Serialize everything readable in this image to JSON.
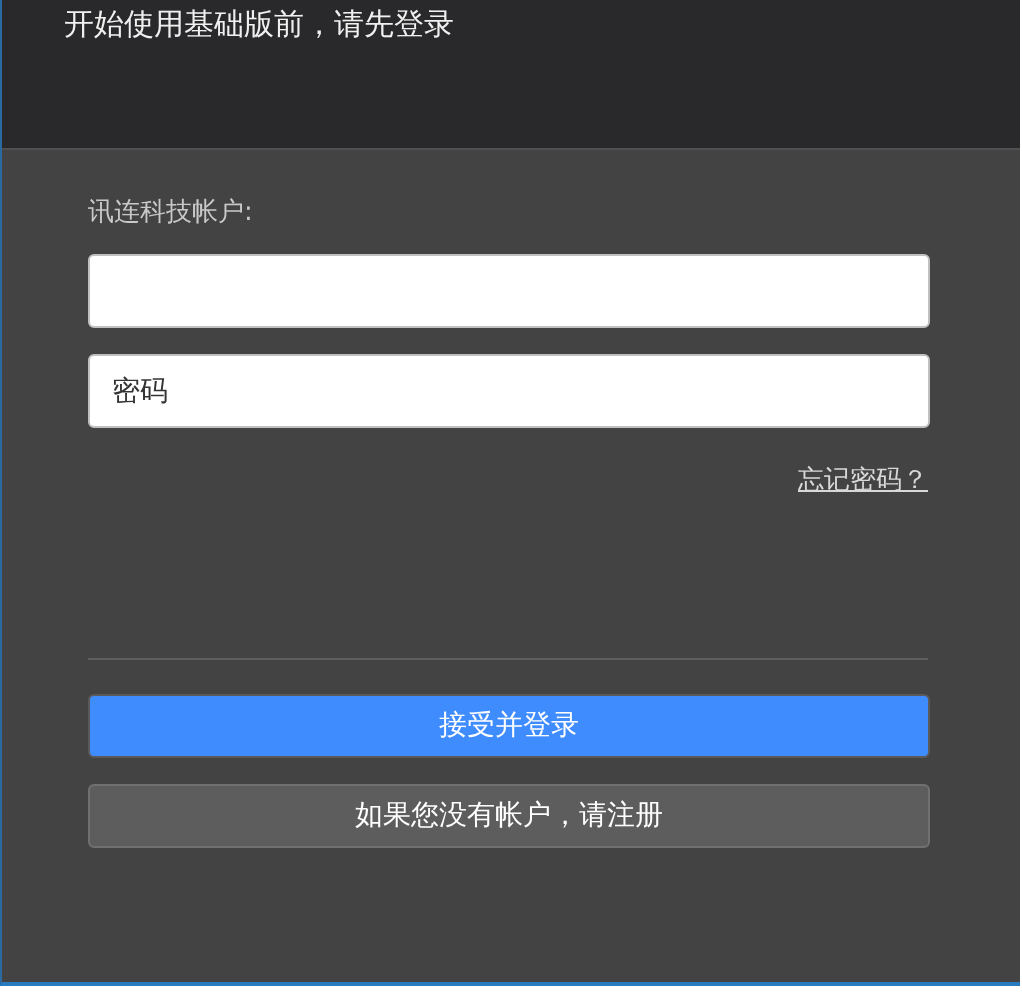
{
  "header": {
    "title": "开始使用基础版前，请先登录"
  },
  "form": {
    "account_label": "讯连科技帐户:",
    "password_field": {
      "placeholder": "密码"
    },
    "forgot_link": "忘记密码？"
  },
  "buttons": [
    {
      "label": "接受并登录",
      "kind": "primary"
    },
    {
      "label": "如果您没有帐户，请注册",
      "kind": "secondary"
    }
  ]
}
